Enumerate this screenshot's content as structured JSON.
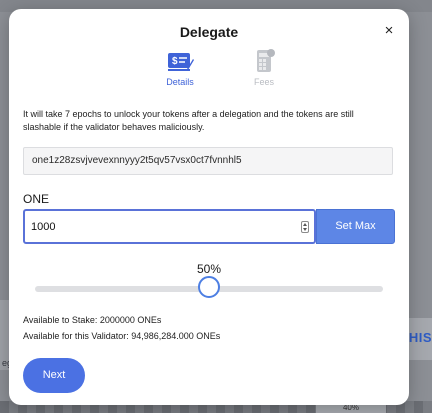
{
  "background": {
    "right_heading_fragment": "HIS",
    "left_text_fragment": "ega",
    "bottom_right_text": "40%"
  },
  "modal": {
    "title": "Delegate",
    "close_glyph": "×",
    "tabs": [
      {
        "label": "Details",
        "icon": "money-card-icon",
        "active": true,
        "color": "#3f63d8"
      },
      {
        "label": "Fees",
        "icon": "calculator-icon",
        "active": false,
        "color": "#b9bcc2"
      }
    ],
    "notice": "It will take 7 epochs to unlock your tokens after a delegation and the tokens are still slashable if the validator behaves maliciously.",
    "validator_address": "one1z28zsvjvevexnnyyy2t5qv57vsx0ct7fvnnhl5",
    "amount_label": "ONE",
    "amount_value": "1000",
    "set_max_label": "Set Max",
    "slider_percent_text": "50%",
    "slider_fraction": 0.5,
    "available_to_stake": "Available to Stake: 2000000 ONEs",
    "available_for_validator": "Available for this Validator: 94,986,284.000 ONEs",
    "next_label": "Next"
  },
  "colors": {
    "accent": "#4b71e3",
    "set_max_bg": "#5d86e6",
    "input_border": "#5a72d8",
    "overlay": "#8c8f95"
  }
}
